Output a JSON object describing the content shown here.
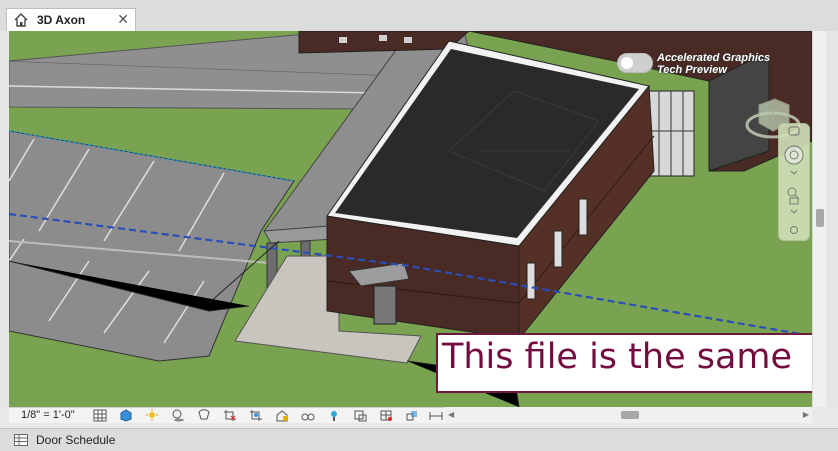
{
  "tab": {
    "title": "3D Axon",
    "close": "✕",
    "home_icon": "home-icon"
  },
  "toggle": {
    "line1": "Accelerated Graphics",
    "line2": "Tech Preview",
    "state": "off"
  },
  "banner": {
    "text": "This file is the same"
  },
  "view_control_bar": {
    "scale": "1/8\" = 1'-0\"",
    "icons": [
      "detail-level-icon",
      "visual-style-icon",
      "sun-path-icon",
      "shadows-icon",
      "render-icon",
      "crop-view-icon",
      "show-crop-icon",
      "unlock-3d-icon",
      "temporary-hide-icon",
      "reveal-hidden-icon",
      "analytical-model-icon",
      "highlight-displacement-icon",
      "constraints-icon",
      "worksharing-icon",
      "view-properties-icon"
    ]
  },
  "bottom": {
    "schedule_label": "Door Schedule",
    "schedule_icon": "schedule-icon"
  },
  "colors": {
    "grass": "#7aa351",
    "road": "#8c8c8c",
    "roof": "#2a2a2a",
    "brick": "#4a2a24",
    "banner_text": "#730c3f"
  }
}
